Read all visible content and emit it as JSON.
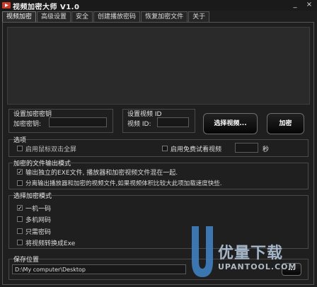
{
  "app": {
    "title": "视频加密大师 V1.0"
  },
  "window_buttons": {
    "minimize": "_",
    "close": "×"
  },
  "tabs": [
    {
      "label": "视频加密"
    },
    {
      "label": "高级设置"
    },
    {
      "label": "安全"
    },
    {
      "label": "创建播放密码"
    },
    {
      "label": "恢复加密文件"
    },
    {
      "label": "关于"
    }
  ],
  "encrypt_key": {
    "title": "设置加密密钥",
    "label": "加密密钥:",
    "value": ""
  },
  "video_id": {
    "title": "设置视频 ID",
    "label": "视频 ID:",
    "value": ""
  },
  "buttons": {
    "select_video": "选择视频...",
    "encrypt": "加密",
    "browse": "..."
  },
  "options": {
    "title": "选项",
    "mouse_double_click": {
      "label": "启用鼠标双击全屏",
      "checked": false
    },
    "free_trial": {
      "label": "启用免费试看视频",
      "checked": false,
      "seconds_value": "",
      "unit": "秒"
    }
  },
  "output_mode": {
    "title": "加密的文件输出模式",
    "items": [
      {
        "label": "输出独立的EXE文件, 播放器和加密视频文件混在一起.",
        "checked": true
      },
      {
        "label": "分离输出播放器和加密的视频文件,如果视频体积比较大此项加载速度快些.",
        "checked": false
      }
    ]
  },
  "encrypt_mode": {
    "title": "选择加密模式",
    "items": [
      {
        "label": "一机一码",
        "checked": true
      },
      {
        "label": "多机网码",
        "checked": false
      },
      {
        "label": "只需密码",
        "checked": false
      },
      {
        "label": "将视频转换成Exe",
        "checked": false
      }
    ]
  },
  "save_location": {
    "title": "保存位置",
    "value": "D:\\My computer\\Desktop"
  },
  "watermark": {
    "brand": "优量下载",
    "url": "UPANTOOL.COM"
  },
  "colors": {
    "background": "#1e1e1e",
    "text": "#e8e8e8",
    "watermark_blue": "#3f7fc0"
  }
}
